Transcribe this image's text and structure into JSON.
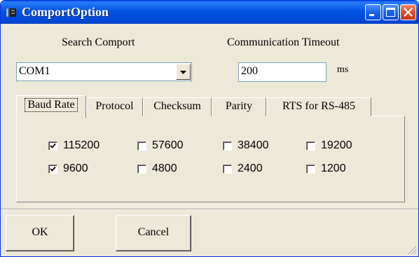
{
  "window": {
    "title": "ComportOption",
    "controls": {
      "minimize": "minimize-icon",
      "maximize": "maximize-icon",
      "close": "close-icon"
    }
  },
  "search_comport": {
    "label": "Search Comport",
    "selected": "COM1"
  },
  "timeout": {
    "label": "Communication Timeout",
    "value": "200",
    "unit": "ms"
  },
  "tabs": [
    {
      "label": "Baud Rate",
      "active": true
    },
    {
      "label": "Protocol",
      "active": false
    },
    {
      "label": "Checksum",
      "active": false
    },
    {
      "label": "Parity",
      "active": false
    },
    {
      "label": "RTS for RS-485",
      "active": false
    }
  ],
  "baud_rates": [
    {
      "label": "115200",
      "checked": true
    },
    {
      "label": "57600",
      "checked": false
    },
    {
      "label": "38400",
      "checked": false
    },
    {
      "label": "19200",
      "checked": false
    },
    {
      "label": "9600",
      "checked": true
    },
    {
      "label": "4800",
      "checked": false
    },
    {
      "label": "2400",
      "checked": false
    },
    {
      "label": "1200",
      "checked": false
    }
  ],
  "buttons": {
    "ok": "OK",
    "cancel": "Cancel"
  }
}
